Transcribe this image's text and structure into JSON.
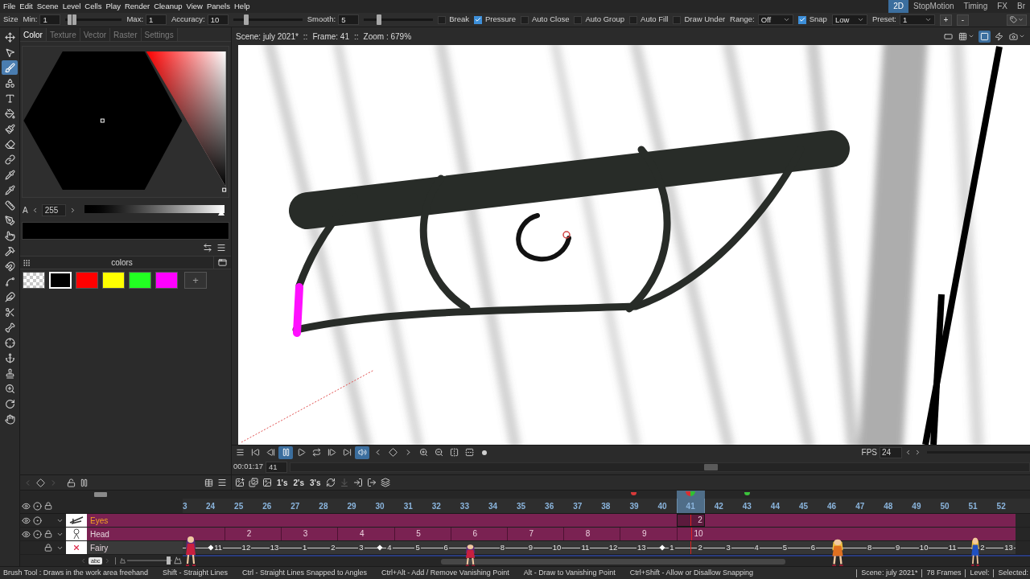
{
  "menu_bar": {
    "items": [
      "File",
      "Edit",
      "Scene",
      "Level",
      "Cells",
      "Play",
      "Render",
      "Cleanup",
      "View",
      "Panels",
      "Help"
    ],
    "rooms": [
      {
        "label": "2D",
        "selected": true
      },
      {
        "label": "StopMotion",
        "selected": false
      },
      {
        "label": "Timing",
        "selected": false
      },
      {
        "label": "FX",
        "selected": false
      },
      {
        "label": "Br",
        "selected": false
      }
    ]
  },
  "tool_options": {
    "items": [
      {
        "kind": "label",
        "text": "Size"
      },
      {
        "kind": "field",
        "label": "Min:",
        "value": "1"
      },
      {
        "kind": "range_slider",
        "level": 0.04
      },
      {
        "kind": "field",
        "label": "Max:",
        "value": "1"
      },
      {
        "kind": "field",
        "label": "Accuracy:",
        "value": "10"
      },
      {
        "kind": "slider",
        "level": 0.16
      },
      {
        "kind": "field",
        "label": "Smooth:",
        "value": "5"
      },
      {
        "kind": "slider",
        "level": 0.2
      },
      {
        "kind": "checkbox",
        "label": "Break",
        "checked": false
      },
      {
        "kind": "checkbox",
        "label": "Pressure",
        "checked": true
      },
      {
        "kind": "checkbox",
        "label": "Auto Close",
        "checked": false
      },
      {
        "kind": "checkbox",
        "label": "Auto Group",
        "checked": false
      },
      {
        "kind": "checkbox",
        "label": "Auto Fill",
        "checked": false
      },
      {
        "kind": "checkbox",
        "label": "Draw Under",
        "checked": false
      },
      {
        "kind": "dropdown",
        "label": "Range:",
        "value": "Off"
      },
      {
        "kind": "checkbox",
        "label": "Snap",
        "checked": true
      },
      {
        "kind": "dropdown",
        "value": "Low"
      },
      {
        "kind": "dropdown",
        "label": "Preset:",
        "value": "1"
      },
      {
        "kind": "button",
        "text": "+"
      },
      {
        "kind": "button",
        "text": "-"
      }
    ]
  },
  "tools": [
    {
      "kind": "animate",
      "selected": false
    },
    {
      "kind": "selection",
      "selected": false
    },
    {
      "kind": "brush",
      "selected": true
    },
    {
      "kind": "geometric",
      "selected": false
    },
    {
      "kind": "type",
      "selected": false
    },
    {
      "kind": "fill",
      "selected": false
    },
    {
      "kind": "paint_brush",
      "selected": false
    },
    {
      "kind": "eraser",
      "selected": false
    },
    {
      "kind": "tape",
      "selected": false
    },
    {
      "kind": "style_picker",
      "selected": false
    },
    {
      "kind": "rgb_picker",
      "selected": false
    },
    {
      "kind": "ruler",
      "selected": false
    },
    {
      "kind": "control_point",
      "selected": false
    },
    {
      "kind": "pinch",
      "selected": false
    },
    {
      "kind": "pump",
      "selected": false
    },
    {
      "kind": "magnet",
      "selected": false
    },
    {
      "kind": "bender",
      "selected": false
    },
    {
      "kind": "iron",
      "selected": false
    },
    {
      "kind": "cutter",
      "selected": false
    },
    {
      "kind": "skeleton",
      "selected": false
    },
    {
      "kind": "tracker",
      "selected": false
    },
    {
      "kind": "hook",
      "selected": false
    },
    {
      "kind": "plastic",
      "selected": false
    },
    {
      "kind": "zoom",
      "selected": false
    },
    {
      "kind": "rotate",
      "selected": false
    },
    {
      "kind": "hand",
      "selected": false
    }
  ],
  "style_editor": {
    "tabs": [
      {
        "label": "Color",
        "selected": true
      },
      {
        "label": "Texture",
        "selected": false
      },
      {
        "label": "Vector",
        "selected": false
      },
      {
        "label": "Raster",
        "selected": false
      },
      {
        "label": "Settings",
        "selected": false
      }
    ],
    "alpha": {
      "label": "A",
      "value": "255",
      "level": 1
    },
    "palette": {
      "title": "colors",
      "swatches": [
        {
          "kind": "transparent",
          "selected": false
        },
        {
          "kind": "solid",
          "color": "#000000",
          "selected": true
        },
        {
          "kind": "solid",
          "color": "#ff0000",
          "selected": false
        },
        {
          "kind": "solid",
          "color": "#ffff00",
          "selected": false
        },
        {
          "kind": "solid",
          "color": "#22ff22",
          "selected": false
        },
        {
          "kind": "solid",
          "color": "#ff00ff",
          "selected": false
        }
      ],
      "add_label": "+"
    }
  },
  "viewer": {
    "info": [
      "Scene: july 2021*",
      "::",
      "Frame: 41",
      "::",
      "Zoom : 679%"
    ],
    "toggles": [
      {
        "kind": "camera_box",
        "active": false
      },
      {
        "kind": "grid",
        "active": false
      },
      {
        "kind": "preview",
        "active": true
      },
      {
        "kind": "sub_preview",
        "active": false
      },
      {
        "kind": "camera",
        "active": false
      }
    ]
  },
  "playback": {
    "buttons": [
      {
        "kind": "menu",
        "active": false
      },
      {
        "kind": "first",
        "active": false
      },
      {
        "kind": "prev",
        "active": false
      },
      {
        "kind": "pause",
        "active": true
      },
      {
        "kind": "play",
        "active": false
      },
      {
        "kind": "loop",
        "active": false
      },
      {
        "kind": "next",
        "active": false
      },
      {
        "kind": "last",
        "active": false
      },
      {
        "kind": "sound",
        "active": true
      },
      {
        "kind": "key_prev",
        "active": false
      },
      {
        "kind": "key",
        "active": false
      },
      {
        "kind": "key_next",
        "active": false
      },
      {
        "kind": "zoom_in",
        "active": false
      },
      {
        "kind": "zoom_out",
        "active": false
      },
      {
        "kind": "flip_h",
        "active": false
      },
      {
        "kind": "flip_v",
        "active": false
      },
      {
        "kind": "dot",
        "active": false
      }
    ],
    "fps_label": "FPS",
    "fps": "24",
    "time": "00:01:17",
    "frame": "41",
    "level": 0.57
  },
  "timeline_toolbar": {
    "step_buttons": [
      "1's",
      "2's",
      "3's"
    ]
  },
  "timeline": {
    "frames": [
      {
        "label": "3",
        "selected": false
      },
      {
        "label": "24",
        "selected": false
      },
      {
        "label": "25",
        "selected": false
      },
      {
        "label": "26",
        "selected": false
      },
      {
        "label": "27",
        "selected": false
      },
      {
        "label": "28",
        "selected": false
      },
      {
        "label": "29",
        "selected": false
      },
      {
        "label": "30",
        "selected": false
      },
      {
        "label": "31",
        "selected": false
      },
      {
        "label": "32",
        "selected": false
      },
      {
        "label": "33",
        "selected": false
      },
      {
        "label": "34",
        "selected": false
      },
      {
        "label": "35",
        "selected": false
      },
      {
        "label": "36",
        "selected": false
      },
      {
        "label": "37",
        "selected": false
      },
      {
        "label": "38",
        "selected": false
      },
      {
        "label": "39",
        "selected": false,
        "color": "#d83a3a"
      },
      {
        "label": "40",
        "selected": false
      },
      {
        "label": "41",
        "selected": true
      },
      {
        "label": "42",
        "selected": false
      },
      {
        "label": "43",
        "selected": false,
        "color": "#3cc43c"
      },
      {
        "label": "44",
        "selected": false
      },
      {
        "label": "45",
        "selected": false
      },
      {
        "label": "46",
        "selected": false
      },
      {
        "label": "47",
        "selected": false
      },
      {
        "label": "48",
        "selected": false
      },
      {
        "label": "49",
        "selected": false
      },
      {
        "label": "50",
        "selected": false
      },
      {
        "label": "51",
        "selected": false
      },
      {
        "label": "52",
        "selected": false
      }
    ],
    "layers": [
      {
        "name": "Eyes",
        "selected": true,
        "kind": "vector",
        "thumbnail": {
          "kind": "eye_sketch"
        },
        "preview_visible": true,
        "camstand_visible": true,
        "locked": false,
        "cells": [
          {
            "selected": false
          },
          {
            "selected": false
          },
          {
            "selected": false
          },
          {
            "selected": false
          },
          {
            "selected": false
          },
          {
            "selected": false
          },
          {
            "selected": false
          },
          {
            "selected": false
          },
          {
            "selected": false
          },
          {
            "selected": false
          },
          {
            "selected": false
          },
          {
            "selected": false
          },
          {
            "selected": false
          },
          {
            "selected": false
          },
          {
            "selected": false
          },
          {
            "selected": false
          },
          {
            "selected": false
          },
          {
            "selected": false
          },
          {
            "text": "2",
            "selected": true
          },
          {
            "selected": false
          },
          {
            "selected": false
          },
          {
            "selected": false
          },
          {
            "selected": false
          },
          {
            "selected": false
          },
          {
            "selected": false
          },
          {
            "selected": false
          },
          {
            "selected": false
          },
          {
            "selected": false
          },
          {
            "selected": false
          },
          {
            "selected": false
          }
        ]
      },
      {
        "name": "Head",
        "selected": false,
        "kind": "vector",
        "thumbnail": {
          "kind": "figure"
        },
        "preview_visible": true,
        "camstand_visible": true,
        "locked": true,
        "cells": [
          {
            "selected": false
          },
          {
            "selected": false
          },
          {
            "text": "2",
            "selected": false
          },
          {
            "selected": false
          },
          {
            "text": "3",
            "selected": false
          },
          {
            "selected": false
          },
          {
            "text": "4",
            "selected": false
          },
          {
            "selected": false
          },
          {
            "text": "5",
            "selected": false
          },
          {
            "selected": false
          },
          {
            "text": "6",
            "selected": false
          },
          {
            "selected": false
          },
          {
            "text": "7",
            "selected": false
          },
          {
            "selected": false
          },
          {
            "text": "8",
            "selected": false
          },
          {
            "selected": false
          },
          {
            "text": "9",
            "selected": false
          },
          {
            "selected": false
          },
          {
            "text": "10",
            "selected": false
          },
          {
            "selected": false
          },
          {
            "selected": false
          },
          {
            "selected": false
          },
          {
            "selected": false
          },
          {
            "selected": false
          },
          {
            "selected": false
          },
          {
            "selected": false
          },
          {
            "selected": false
          },
          {
            "selected": false
          },
          {
            "selected": false
          },
          {
            "selected": false
          }
        ]
      },
      {
        "name": "Fairy",
        "selected": false,
        "kind": "raster",
        "thumbnail": {
          "kind": "cross"
        },
        "preview_visible": false,
        "camstand_visible": false,
        "locked": true,
        "cells": [
          {
            "kind": "plain",
            "selected": false
          },
          {
            "kind": "key",
            "text": "11",
            "selected": false
          },
          {
            "kind": "plain",
            "text": "12",
            "selected": false
          },
          {
            "kind": "plain",
            "text": "13",
            "selected": false
          },
          {
            "kind": "plain",
            "text": "1",
            "selected": false
          },
          {
            "kind": "plain",
            "text": "2",
            "selected": false
          },
          {
            "kind": "plain",
            "text": "3",
            "selected": false
          },
          {
            "kind": "key",
            "text": "4",
            "selected": false
          },
          {
            "kind": "plain",
            "text": "5",
            "selected": false
          },
          {
            "kind": "plain",
            "text": "6",
            "selected": false
          },
          {
            "kind": "plain",
            "selected": false
          },
          {
            "kind": "plain",
            "text": "8",
            "selected": false
          },
          {
            "kind": "plain",
            "text": "9",
            "selected": false
          },
          {
            "kind": "plain",
            "text": "10",
            "selected": false
          },
          {
            "kind": "plain",
            "text": "11",
            "selected": false
          },
          {
            "kind": "plain",
            "text": "12",
            "selected": false
          },
          {
            "kind": "plain",
            "text": "13",
            "selected": false
          },
          {
            "kind": "key",
            "text": "1",
            "selected": false
          },
          {
            "kind": "plain",
            "text": "2",
            "selected": false
          },
          {
            "kind": "plain",
            "text": "3",
            "selected": false
          },
          {
            "kind": "plain",
            "text": "4",
            "selected": false
          },
          {
            "kind": "plain",
            "text": "5",
            "selected": false
          },
          {
            "kind": "plain",
            "text": "6",
            "selected": false
          },
          {
            "kind": "plain",
            "selected": false
          },
          {
            "kind": "plain",
            "text": "8",
            "selected": false
          },
          {
            "kind": "plain",
            "text": "9",
            "selected": false
          },
          {
            "kind": "plain",
            "text": "10",
            "selected": false
          },
          {
            "kind": "plain",
            "text": "11",
            "selected": false
          },
          {
            "kind": "plain",
            "text": "2",
            "selected": false
          },
          {
            "kind": "plain",
            "text": "13",
            "selected": false
          }
        ]
      }
    ],
    "name_toggle": "abc",
    "frame_zoom": {
      "level": 0.95
    }
  },
  "status_bar": {
    "hints": [
      "Brush Tool : Draws in the work area freehand",
      "Shift - Straight Lines",
      "Ctrl - Straight Lines Snapped to Angles",
      "Ctrl+Alt - Add / Remove Vanishing Point",
      "Alt - Draw to Vanishing Point",
      "Ctrl+Shift - Allow or Disallow Snapping"
    ],
    "info": [
      "Scene: july 2021*",
      "78 Frames",
      "Level:",
      "Selected:"
    ]
  }
}
